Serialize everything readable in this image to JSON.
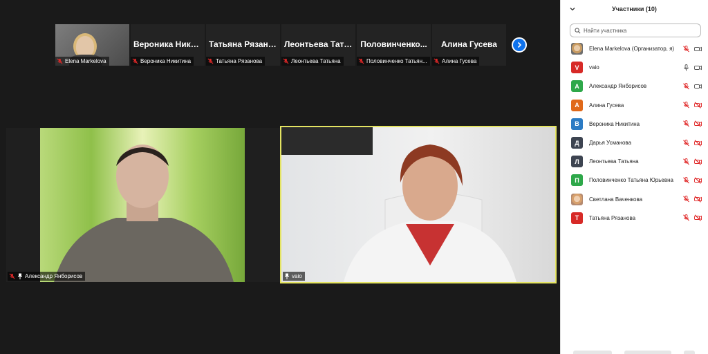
{
  "thumbnails": [
    {
      "big_name": "",
      "label": "Elena Markelova",
      "photo": true
    },
    {
      "big_name": "Вероника Ники...",
      "label": "Вероника Никитина"
    },
    {
      "big_name": "Татьяна Рязано...",
      "label": "Татьяна Рязанова"
    },
    {
      "big_name": "Леонтьева Тать...",
      "label": "Леонтьева Татьяна"
    },
    {
      "big_name": "Половинченко...",
      "label": "Половинченко Татьян..."
    },
    {
      "big_name": "Алина Гусева",
      "label": "Алина Гусева"
    }
  ],
  "next_button_icon": "chevron-right-icon",
  "tiles": {
    "alexander": {
      "label": "Александр Янборисов"
    },
    "vaio": {
      "label": "vaio"
    }
  },
  "panel": {
    "title": "Участники (10)",
    "search_placeholder": "Найти участника",
    "participants": [
      {
        "name": "Elena Markelova (Организатор, я)",
        "avatar": "photo",
        "avatar_letter": "",
        "avatar_color": "",
        "mic": "muted",
        "video": "on"
      },
      {
        "name": "vaio",
        "avatar_letter": "V",
        "avatar_color": "#d72a27",
        "mic": "on",
        "video": "on"
      },
      {
        "name": "Александр Янборисов",
        "avatar_letter": "A",
        "avatar_color": "#2ea84a",
        "mic": "muted",
        "video": "on"
      },
      {
        "name": "Алина Гусева",
        "avatar_letter": "A",
        "avatar_color": "#e0691a",
        "mic": "muted",
        "video": "off"
      },
      {
        "name": "Вероника Никитина",
        "avatar_letter": "B",
        "avatar_color": "#2b7bc4",
        "mic": "muted",
        "video": "off"
      },
      {
        "name": "Дарья Усманова",
        "avatar_letter": "Д",
        "avatar_color": "#3d4451",
        "mic": "muted",
        "video": "off"
      },
      {
        "name": "Леонтьева Татьяна",
        "avatar_letter": "Л",
        "avatar_color": "#3d4451",
        "mic": "muted",
        "video": "off"
      },
      {
        "name": "Половинченко Татьяна Юрьевна",
        "avatar_letter": "П",
        "avatar_color": "#2ea84a",
        "mic": "muted",
        "video": "off"
      },
      {
        "name": "Светлана Ваченкова",
        "avatar": "photo",
        "avatar_letter": "",
        "avatar_color": "",
        "mic": "muted",
        "video": "off"
      },
      {
        "name": "Татьяна Рязанова",
        "avatar_letter": "T",
        "avatar_color": "#d72a27",
        "mic": "muted",
        "video": "off"
      }
    ]
  },
  "colors": {
    "accent_blue": "#0e72ed",
    "muted_red": "#e02828",
    "active_speaker": "#e4e462"
  }
}
